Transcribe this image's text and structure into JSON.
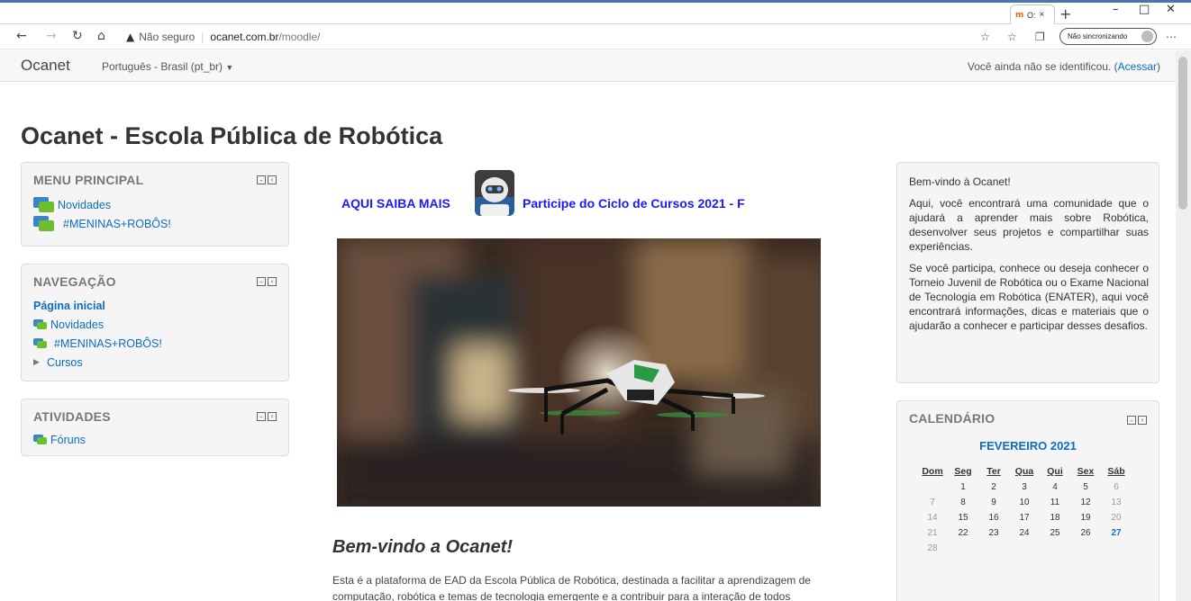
{
  "browser": {
    "tab_title": "O:",
    "address_warning": "Não seguro",
    "url_host": "ocanet.com.br",
    "url_path": "/moodle/",
    "sync_label": "Não sincronizando"
  },
  "navbar": {
    "brand": "Ocanet",
    "language": "Português - Brasil (pt_br)",
    "login_text": "Você ainda não se identificou. (",
    "login_link": "Acessar",
    "login_close": ")"
  },
  "page": {
    "title": "Ocanet - Escola Pública de Robótica"
  },
  "menu_principal": {
    "title": "MENU PRINCIPAL",
    "items": [
      "Novidades",
      "#MENINAS+ROBÔS!"
    ]
  },
  "navegacao": {
    "title": "NAVEGAÇÃO",
    "home": "Página inicial",
    "items": [
      "Novidades",
      "#MENINAS+ROBÔS!"
    ],
    "courses": "Cursos"
  },
  "atividades": {
    "title": "ATIVIDADES",
    "items": [
      "Fóruns"
    ]
  },
  "center": {
    "banner_left": "AQUI SAIBA MAIS",
    "banner_right": "Participe do Ciclo de Cursos 2021 - F",
    "welcome_title": "Bem-vindo a Ocanet!",
    "welcome_text": "Esta é a plataforma de EAD da Escola Pública de Robótica, destinada a facilitar a aprendizagem de computação, robótica e temas de tecnologia emergente e a contribuir para a interação de todos"
  },
  "right_info": {
    "heading": "Bem-vindo à Ocanet!",
    "p1": "Aqui, você encontrará uma comunidade que o ajudará a aprender mais sobre Robótica, desenvolver seus projetos e compartilhar suas experiências.",
    "p2": "Se você participa, conhece ou deseja conhecer o Torneio Juvenil de Robótica ou o Exame Nacional de Tecnologia em Robótica (ENATER), aqui você encontrará informações, dicas e materiais que o ajudarão a conhecer e participar desses desafios."
  },
  "calendar": {
    "title": "CALENDÁRIO",
    "month": "FEVEREIRO 2021",
    "weekdays": [
      "Dom",
      "Seg",
      "Ter",
      "Qua",
      "Qui",
      "Sex",
      "Sáb"
    ],
    "weeks": [
      [
        "",
        "1",
        "2",
        "3",
        "4",
        "5",
        "6"
      ],
      [
        "7",
        "8",
        "9",
        "10",
        "11",
        "12",
        "13"
      ],
      [
        "14",
        "15",
        "16",
        "17",
        "18",
        "19",
        "20"
      ],
      [
        "21",
        "22",
        "23",
        "24",
        "25",
        "26",
        "27"
      ],
      [
        "28",
        "",
        "",
        "",
        "",
        "",
        ""
      ]
    ],
    "today": "27"
  },
  "colors": {
    "link": "#0f6cbf",
    "banner": "#1a1aff",
    "block_bg": "#f5f5f5"
  }
}
